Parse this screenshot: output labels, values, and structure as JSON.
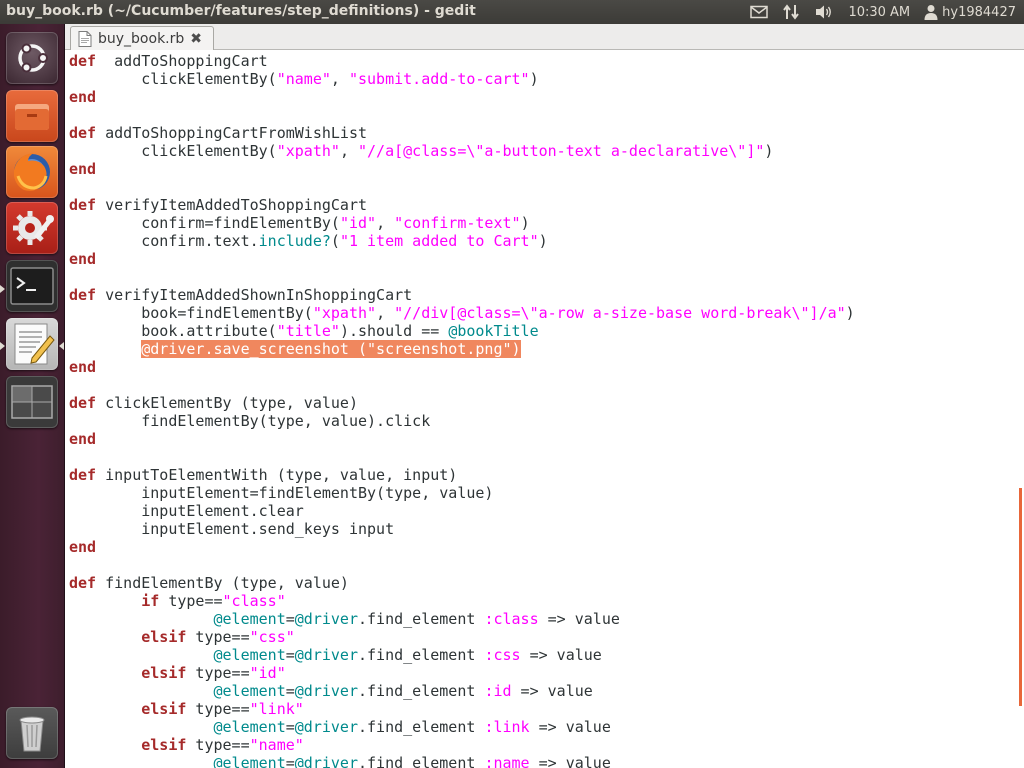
{
  "window": {
    "title": "buy_book.rb (~/Cucumber/features/step_definitions) - gedit"
  },
  "panel": {
    "time": "10:30 AM",
    "user": "hy1984427",
    "icons": [
      "mail-icon",
      "network-icon",
      "volume-icon",
      "user-icon"
    ]
  },
  "launcher": {
    "items": [
      "ubuntu-dash-icon",
      "files-icon",
      "firefox-icon",
      "system-settings-icon",
      "terminal-icon",
      "text-editor-icon",
      "workspace-switcher-icon",
      "trash-icon"
    ]
  },
  "editor": {
    "tab_label": "buy_book.rb",
    "highlight_color": "#f0875e",
    "lines": [
      [
        [
          "kw",
          "def"
        ],
        [
          "",
          "  addToShoppingCart"
        ]
      ],
      [
        [
          "",
          "        clickElementBy("
        ],
        [
          "st",
          "\"name\""
        ],
        [
          "",
          ", "
        ],
        [
          "st",
          "\"submit.add-to-cart\""
        ],
        [
          "",
          ")"
        ]
      ],
      [
        [
          "kw",
          "end"
        ]
      ],
      [],
      [
        [
          "kw",
          "def"
        ],
        [
          "",
          " addToShoppingCartFromWishList"
        ]
      ],
      [
        [
          "",
          "        clickElementBy("
        ],
        [
          "st",
          "\"xpath\""
        ],
        [
          "",
          ", "
        ],
        [
          "st",
          "\"//a[@class=\\\"a-button-text a-declarative\\\"]\""
        ],
        [
          "",
          ")"
        ]
      ],
      [
        [
          "kw",
          "end"
        ]
      ],
      [],
      [
        [
          "kw",
          "def"
        ],
        [
          "",
          " verifyItemAddedToShoppingCart"
        ]
      ],
      [
        [
          "",
          "        confirm=findElementBy("
        ],
        [
          "st",
          "\"id\""
        ],
        [
          "",
          ", "
        ],
        [
          "st",
          "\"confirm-text\""
        ],
        [
          "",
          ")"
        ]
      ],
      [
        [
          "",
          "        confirm.text."
        ],
        [
          "fn",
          "include?"
        ],
        [
          "",
          "("
        ],
        [
          "st",
          "\"1 item added to Cart\""
        ],
        [
          "",
          ")"
        ]
      ],
      [
        [
          "kw",
          "end"
        ]
      ],
      [],
      [
        [
          "kw",
          "def"
        ],
        [
          "",
          " verifyItemAddedShownInShoppingCart"
        ]
      ],
      [
        [
          "",
          "        book=findElementBy("
        ],
        [
          "st",
          "\"xpath\""
        ],
        [
          "",
          ", "
        ],
        [
          "st",
          "\"//div[@class=\\\"a-row a-size-base word-break\\\"]/a\""
        ],
        [
          "",
          ")"
        ]
      ],
      [
        [
          "",
          "        book.attribute("
        ],
        [
          "st",
          "\"title\""
        ],
        [
          "",
          ").should == "
        ],
        [
          "fn",
          "@bookTitle"
        ]
      ],
      [
        [
          "",
          "        "
        ],
        [
          "hl",
          "@driver.save_screenshot (\"screenshot.png\")"
        ]
      ],
      [
        [
          "kw",
          "end"
        ]
      ],
      [],
      [
        [
          "kw",
          "def"
        ],
        [
          "",
          " clickElementBy (type, value)"
        ]
      ],
      [
        [
          "",
          "        findElementBy(type, value).click"
        ]
      ],
      [
        [
          "kw",
          "end"
        ]
      ],
      [],
      [
        [
          "kw",
          "def"
        ],
        [
          "",
          " inputToElementWith (type, value, input)"
        ]
      ],
      [
        [
          "",
          "        inputElement=findElementBy(type, value)"
        ]
      ],
      [
        [
          "",
          "        inputElement.clear"
        ]
      ],
      [
        [
          "",
          "        inputElement.send_keys input"
        ]
      ],
      [
        [
          "kw",
          "end"
        ]
      ],
      [],
      [
        [
          "kw",
          "def"
        ],
        [
          "",
          " findElementBy (type, value)"
        ]
      ],
      [
        [
          "",
          "        "
        ],
        [
          "kw",
          "if"
        ],
        [
          "",
          " type=="
        ],
        [
          "st",
          "\"class\""
        ]
      ],
      [
        [
          "",
          "                "
        ],
        [
          "fn",
          "@element"
        ],
        [
          "",
          "="
        ],
        [
          "fn",
          "@driver"
        ],
        [
          "",
          ".find_element "
        ],
        [
          "st",
          ":class"
        ],
        [
          "",
          " => value"
        ]
      ],
      [
        [
          "",
          "        "
        ],
        [
          "kw",
          "elsif"
        ],
        [
          "",
          " type=="
        ],
        [
          "st",
          "\"css\""
        ]
      ],
      [
        [
          "",
          "                "
        ],
        [
          "fn",
          "@element"
        ],
        [
          "",
          "="
        ],
        [
          "fn",
          "@driver"
        ],
        [
          "",
          ".find_element "
        ],
        [
          "st",
          ":css"
        ],
        [
          "",
          " => value"
        ]
      ],
      [
        [
          "",
          "        "
        ],
        [
          "kw",
          "elsif"
        ],
        [
          "",
          " type=="
        ],
        [
          "st",
          "\"id\""
        ]
      ],
      [
        [
          "",
          "                "
        ],
        [
          "fn",
          "@element"
        ],
        [
          "",
          "="
        ],
        [
          "fn",
          "@driver"
        ],
        [
          "",
          ".find_element "
        ],
        [
          "st",
          ":id"
        ],
        [
          "",
          " => value"
        ]
      ],
      [
        [
          "",
          "        "
        ],
        [
          "kw",
          "elsif"
        ],
        [
          "",
          " type=="
        ],
        [
          "st",
          "\"link\""
        ]
      ],
      [
        [
          "",
          "                "
        ],
        [
          "fn",
          "@element"
        ],
        [
          "",
          "="
        ],
        [
          "fn",
          "@driver"
        ],
        [
          "",
          ".find_element "
        ],
        [
          "st",
          ":link"
        ],
        [
          "",
          " => value"
        ]
      ],
      [
        [
          "",
          "        "
        ],
        [
          "kw",
          "elsif"
        ],
        [
          "",
          " type=="
        ],
        [
          "st",
          "\"name\""
        ]
      ],
      [
        [
          "",
          "                "
        ],
        [
          "fn",
          "@element"
        ],
        [
          "",
          "="
        ],
        [
          "fn",
          "@driver"
        ],
        [
          "",
          ".find_element "
        ],
        [
          "st",
          ":name"
        ],
        [
          "",
          " => value"
        ]
      ]
    ]
  }
}
